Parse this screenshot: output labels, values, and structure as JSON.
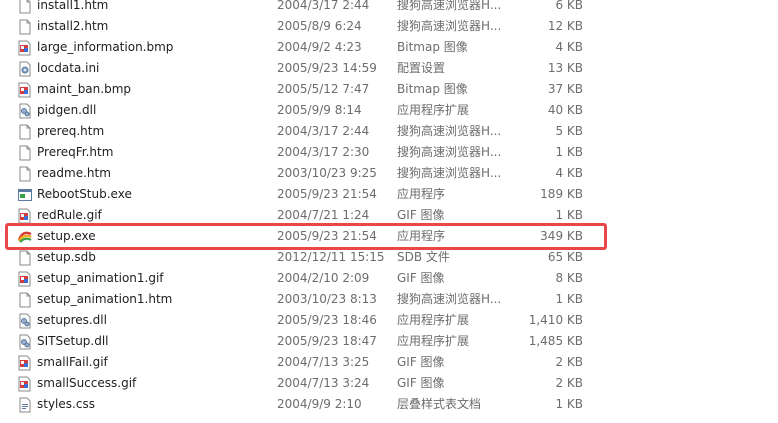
{
  "files": [
    {
      "name": "install1.htm",
      "date": "2004/3/17 2:44",
      "type": "搜狗高速浏览器H...",
      "size": "6 KB",
      "icon": "html-file-icon"
    },
    {
      "name": "install2.htm",
      "date": "2005/8/9 6:24",
      "type": "搜狗高速浏览器H...",
      "size": "12 KB",
      "icon": "html-file-icon"
    },
    {
      "name": "large_information.bmp",
      "date": "2004/9/2 4:23",
      "type": "Bitmap 图像",
      "size": "4 KB",
      "icon": "image-file-icon"
    },
    {
      "name": "locdata.ini",
      "date": "2005/9/23 14:59",
      "type": "配置设置",
      "size": "13 KB",
      "icon": "config-file-icon"
    },
    {
      "name": "maint_ban.bmp",
      "date": "2005/5/12 7:47",
      "type": "Bitmap 图像",
      "size": "37 KB",
      "icon": "image-file-icon"
    },
    {
      "name": "pidgen.dll",
      "date": "2005/9/9 8:14",
      "type": "应用程序扩展",
      "size": "40 KB",
      "icon": "dll-file-icon"
    },
    {
      "name": "prereq.htm",
      "date": "2004/3/17 2:44",
      "type": "搜狗高速浏览器H...",
      "size": "5 KB",
      "icon": "html-file-icon"
    },
    {
      "name": "PrereqFr.htm",
      "date": "2004/3/17 2:30",
      "type": "搜狗高速浏览器H...",
      "size": "1 KB",
      "icon": "html-file-icon"
    },
    {
      "name": "readme.htm",
      "date": "2003/10/23 9:25",
      "type": "搜狗高速浏览器H...",
      "size": "4 KB",
      "icon": "html-file-icon"
    },
    {
      "name": "RebootStub.exe",
      "date": "2005/9/23 21:54",
      "type": "应用程序",
      "size": "189 KB",
      "icon": "exe-file-icon"
    },
    {
      "name": "redRule.gif",
      "date": "2004/7/21 1:24",
      "type": "GIF 图像",
      "size": "1 KB",
      "icon": "image-file-icon"
    },
    {
      "name": "setup.exe",
      "date": "2005/9/23 21:54",
      "type": "应用程序",
      "size": "349 KB",
      "icon": "setup-exe-icon"
    },
    {
      "name": "setup.sdb",
      "date": "2012/12/11 15:15",
      "type": "SDB 文件",
      "size": "65 KB",
      "icon": "generic-file-icon"
    },
    {
      "name": "setup_animation1.gif",
      "date": "2004/2/10 2:09",
      "type": "GIF 图像",
      "size": "8 KB",
      "icon": "image-file-icon"
    },
    {
      "name": "setup_animation1.htm",
      "date": "2003/10/23 8:13",
      "type": "搜狗高速浏览器H...",
      "size": "1 KB",
      "icon": "html-file-icon"
    },
    {
      "name": "setupres.dll",
      "date": "2005/9/23 18:46",
      "type": "应用程序扩展",
      "size": "1,410 KB",
      "icon": "dll-file-icon"
    },
    {
      "name": "SITSetup.dll",
      "date": "2005/9/23 18:47",
      "type": "应用程序扩展",
      "size": "1,485 KB",
      "icon": "dll-file-icon"
    },
    {
      "name": "smallFail.gif",
      "date": "2004/7/13 3:25",
      "type": "GIF 图像",
      "size": "2 KB",
      "icon": "image-file-icon"
    },
    {
      "name": "smallSuccess.gif",
      "date": "2004/7/13 3:24",
      "type": "GIF 图像",
      "size": "2 KB",
      "icon": "image-file-icon"
    },
    {
      "name": "styles.css",
      "date": "2004/9/9 2:10",
      "type": "层叠样式表文档",
      "size": "1 KB",
      "icon": "css-file-icon"
    }
  ],
  "colors": {
    "highlight": "#e8484a",
    "text": "#1e1e1e",
    "muted": "#6d6d6d"
  }
}
